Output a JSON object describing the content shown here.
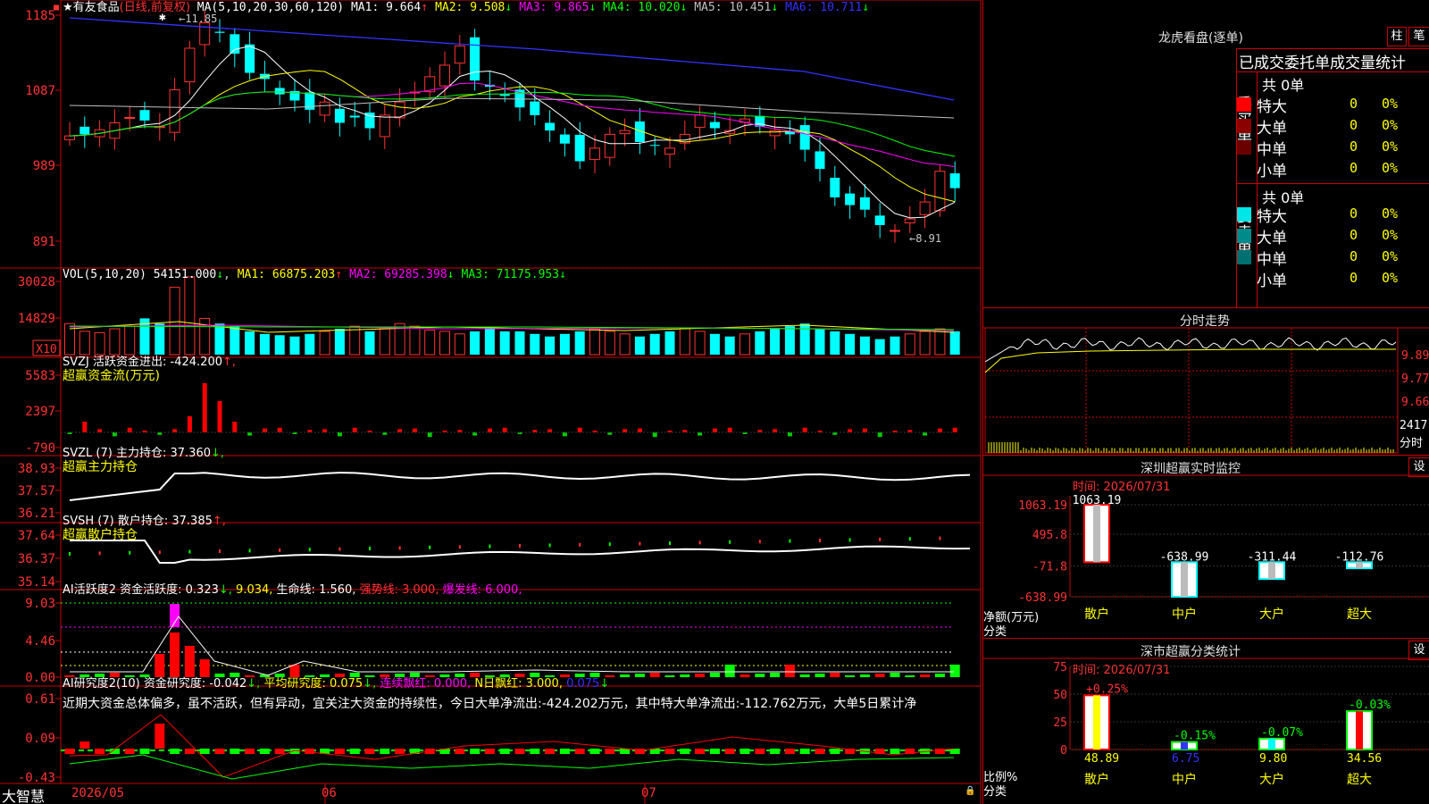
{
  "stock": {
    "title": "★有友食品",
    "mode": "(日线,前复权)",
    "ma_label": "MA(5,10,20,30,60,120)",
    "ma": [
      {
        "label": "MA1:",
        "value": "9.664",
        "arrow": "↑",
        "color": "#ffffff"
      },
      {
        "label": "MA2:",
        "value": "9.508",
        "arrow": "↓",
        "color": "#ffff00"
      },
      {
        "label": "MA3:",
        "value": "9.865",
        "arrow": "↓",
        "color": "#ff00ff"
      },
      {
        "label": "MA4:",
        "value": "10.020",
        "arrow": "↓",
        "color": "#00ff00"
      },
      {
        "label": "MA5:",
        "value": "10.451",
        "arrow": "↓",
        "color": "#c0c0c0"
      },
      {
        "label": "MA6:",
        "value": "10.711",
        "arrow": "↓",
        "color": "#3333ff"
      }
    ],
    "high_mark": "11.85",
    "low_mark": "←8.91",
    "yaxis": [
      "1185",
      "1087",
      "989",
      "891"
    ]
  },
  "vol": {
    "label": "VOL(5,10,20)",
    "value": "54151.000",
    "arrow": "↓",
    "ma": [
      {
        "label": "MA1:",
        "value": "66875.203",
        "arrow": "↑",
        "color": "#ffff00"
      },
      {
        "label": "MA2:",
        "value": "69285.398",
        "arrow": "↓",
        "color": "#ff00ff"
      },
      {
        "label": "MA3:",
        "value": "71175.953",
        "arrow": "↓",
        "color": "#00ff00"
      }
    ],
    "yaxis": [
      "30028",
      "14829"
    ],
    "unit": "X10"
  },
  "svzj": {
    "label": "SVZJ  活跃资金进出:",
    "value": "-424.200",
    "arrow": "↑,",
    "sub": "超赢资金流(万元)",
    "yaxis": [
      "5583",
      "2397",
      "-790"
    ]
  },
  "svzl": {
    "label": "SVZL (7) 主力持仓:",
    "value": "37.360",
    "arrow": "↓,",
    "sub": "超赢主力持仓",
    "yaxis": [
      "38.93",
      "37.57",
      "36.21"
    ]
  },
  "svsh": {
    "label": "SVSH (7) 散户持仓:",
    "value": "37.385",
    "arrow": "↑,",
    "sub": "超赢散户持仓",
    "yaxis": [
      "37.64",
      "36.37",
      "35.14"
    ]
  },
  "ai1": {
    "label": "AI活跃度2 资金活跃度:",
    "value": "0.323",
    "arrow": "↓,",
    "v2": "9.034,",
    "life_label": "生命线:",
    "life": "1.560,",
    "strong": "强势线: 3.000,",
    "burst": "爆发线: 6.000,",
    "yaxis": [
      "9.03",
      "4.46",
      "0.00"
    ]
  },
  "ai2": {
    "label": "AI研究度2(10) 资金研究度:",
    "value": "-0.042",
    "arrow": "↓,",
    "avg": "平均研究度: 0.075",
    "avg_arrow": "↓,",
    "red": "连续飘红: 0.000,",
    "nred": "N日飘红: 3.000,",
    "v5": "0.075",
    "v5_arrow": "↓",
    "text": "近期大资金总体偏多，虽不活跃，但有异动，宜关注大资金的持续性，今日大单净流出:-424.202万元，其中特大单净流出:-112.762万元，大单5日累计净",
    "yaxis": [
      "0.61",
      "0.09",
      "-0.43"
    ]
  },
  "footer": {
    "brand": "大智慧",
    "dates": [
      "2026/05",
      "06",
      "07"
    ]
  },
  "longhu": {
    "title": "龙虎看盘(逐单)",
    "btn1": "柱",
    "btn2": "笔",
    "header": "已成交委托单成交量统计",
    "buy": {
      "side": "委买单",
      "total": "共 0单",
      "rows": [
        {
          "name": "特大",
          "v": "0",
          "p": "0%",
          "color": "#ff0000"
        },
        {
          "name": "大单",
          "v": "0",
          "p": "0%",
          "color": "#8b0000"
        },
        {
          "name": "中单",
          "v": "0",
          "p": "0%",
          "color": "#6b0000"
        },
        {
          "name": "小单",
          "v": "0",
          "p": "0%",
          "color": ""
        }
      ]
    },
    "sell": {
      "side": "委卖单",
      "total": "共 0单",
      "rows": [
        {
          "name": "特大",
          "v": "0",
          "p": "0%",
          "color": "#00e5e5"
        },
        {
          "name": "大单",
          "v": "0",
          "p": "0%",
          "color": "#008b8b"
        },
        {
          "name": "中单",
          "v": "0",
          "p": "0%",
          "color": "#007070"
        },
        {
          "name": "小单",
          "v": "0",
          "p": "0%",
          "color": ""
        }
      ]
    }
  },
  "intraday": {
    "title": "分时走势",
    "yaxis": [
      "9.89",
      "9.77",
      "9.66"
    ],
    "vol_top": "2417",
    "vol_unit": "分时"
  },
  "monitor": {
    "title": "深圳超赢实时监控",
    "btn": "设",
    "time": "时间: 2026/07/31",
    "yaxis": [
      "1063.19",
      "495.8",
      "-71.8",
      "-638.99"
    ],
    "ylabel": "净额(万元)",
    "xlabel": "分类",
    "bars": [
      {
        "cat": "散户",
        "v": "1063.19",
        "num": 1063.19,
        "color": "#ff0000"
      },
      {
        "cat": "中户",
        "v": "-638.99",
        "num": -638.99,
        "color": "#00ffff"
      },
      {
        "cat": "大户",
        "v": "-311.44",
        "num": -311.44,
        "color": "#00ffff"
      },
      {
        "cat": "超大",
        "v": "-112.76",
        "num": -112.76,
        "color": "#00ffff"
      }
    ]
  },
  "classify": {
    "title": "深市超赢分类统计",
    "btn": "设",
    "time": "时间: 2026/07/31",
    "yaxis": [
      "75",
      "50",
      "25",
      "0"
    ],
    "ylabel": "比例%",
    "xlabel": "分类",
    "bars": [
      {
        "cat": "散户",
        "v": "48.89",
        "pct": "+0.25%",
        "num": 48.89,
        "border": "#ff0000",
        "col": "#ffff00"
      },
      {
        "cat": "中户",
        "v": "6.75",
        "pct": "-0.15%",
        "num": 6.75,
        "border": "#00ff00",
        "col": "#3333ff"
      },
      {
        "cat": "大户",
        "v": "9.80",
        "pct": "-0.07%",
        "num": 9.8,
        "border": "#00ff00",
        "col": "#00ffff"
      },
      {
        "cat": "超大",
        "v": "34.56",
        "pct": "-0.03%",
        "num": 34.56,
        "border": "#00ff00",
        "col": "#ff0000"
      }
    ]
  }
}
